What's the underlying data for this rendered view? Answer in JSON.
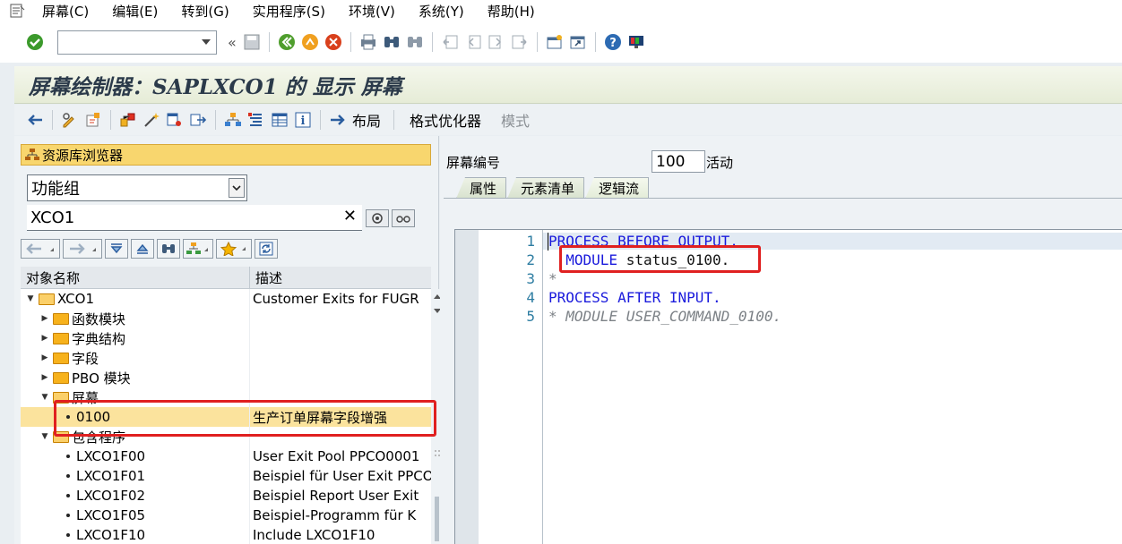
{
  "menu": {
    "items": [
      "屏幕(C)",
      "编辑(E)",
      "转到(G)",
      "实用程序(S)",
      "环境(V)",
      "系统(Y)",
      "帮助(H)"
    ]
  },
  "toolbar": {
    "command_field_value": "",
    "icons": [
      "enter-check-icon",
      "save-icon",
      "back-icon",
      "exit-icon",
      "cancel-icon",
      "print-icon",
      "find-icon",
      "find-next-icon",
      "first-page-icon",
      "prev-page-icon",
      "next-page-icon",
      "last-page-icon",
      "new-session-icon",
      "shortcut-icon",
      "help-icon",
      "customize-layout-icon"
    ],
    "overflow_glyph": "«"
  },
  "title": {
    "text": "屏幕绘制器：SAPLXCO1 的 显示 屏幕"
  },
  "app_toolbar": {
    "layout_label": "布局",
    "format_label": "格式优化器",
    "mode_label": "模式"
  },
  "repository": {
    "header": "资源库浏览器",
    "object_type": "功能组",
    "object_name": "XCO1",
    "clear_glyph": "✕"
  },
  "tree": {
    "columns": [
      "对象名称",
      "描述"
    ],
    "rows": [
      {
        "level": 0,
        "expander": "▼",
        "icon": "folder-open",
        "name": "XCO1",
        "desc": "Customer Exits for FUGR"
      },
      {
        "level": 1,
        "expander": "▶",
        "icon": "folder",
        "name": "函数模块",
        "desc": ""
      },
      {
        "level": 1,
        "expander": "▶",
        "icon": "folder",
        "name": "字典结构",
        "desc": ""
      },
      {
        "level": 1,
        "expander": "▶",
        "icon": "folder",
        "name": "字段",
        "desc": ""
      },
      {
        "level": 1,
        "expander": "▶",
        "icon": "folder",
        "name": "PBO 模块",
        "desc": ""
      },
      {
        "level": 1,
        "expander": "▼",
        "icon": "folder-open",
        "name": "屏幕",
        "desc": ""
      },
      {
        "level": 2,
        "expander": "",
        "icon": "bullet",
        "name": "0100",
        "desc": "生产订单屏幕字段增强",
        "selected": true
      },
      {
        "level": 1,
        "expander": "▼",
        "icon": "folder-open",
        "name": "包含程序",
        "desc": ""
      },
      {
        "level": 2,
        "expander": "",
        "icon": "bullet",
        "name": "LXCO1F00",
        "desc": "User Exit Pool PPCO0001"
      },
      {
        "level": 2,
        "expander": "",
        "icon": "bullet",
        "name": "LXCO1F01",
        "desc": "Beispiel für User Exit PPCO"
      },
      {
        "level": 2,
        "expander": "",
        "icon": "bullet",
        "name": "LXCO1F02",
        "desc": "Beispiel Report User Exit"
      },
      {
        "level": 2,
        "expander": "",
        "icon": "bullet",
        "name": "LXCO1F05",
        "desc": "Beispiel-Programm für K"
      },
      {
        "level": 2,
        "expander": "",
        "icon": "bullet",
        "name": "LXCO1F10",
        "desc": "Include LXCO1F10"
      }
    ]
  },
  "screen": {
    "number_label": "屏幕编号",
    "number_value": "100",
    "status": "活动",
    "tabs": [
      "属性",
      "元素清单",
      "逻辑流"
    ],
    "active_tab": 2
  },
  "code": {
    "lines": [
      {
        "num": "1",
        "parts": [
          {
            "t": "PROCESS BEFORE OUTPUT.",
            "c": "kw"
          }
        ]
      },
      {
        "num": "2",
        "parts": [
          {
            "t": "  MODULE ",
            "c": "kw"
          },
          {
            "t": "status_0100.",
            "c": "tx"
          }
        ]
      },
      {
        "num": "3",
        "parts": [
          {
            "t": "*",
            "c": "cm"
          }
        ]
      },
      {
        "num": "4",
        "parts": [
          {
            "t": "PROCESS AFTER INPUT.",
            "c": "kw"
          }
        ]
      },
      {
        "num": "5",
        "parts": [
          {
            "t": "* MODULE USER_COMMAND_0100.",
            "c": "cm"
          }
        ]
      }
    ]
  },
  "colors": {
    "highlight_red": "#e02020",
    "selected_row": "#fbe39d",
    "repo_header": "#f8d66e",
    "keyword_blue": "#1a1adc"
  }
}
